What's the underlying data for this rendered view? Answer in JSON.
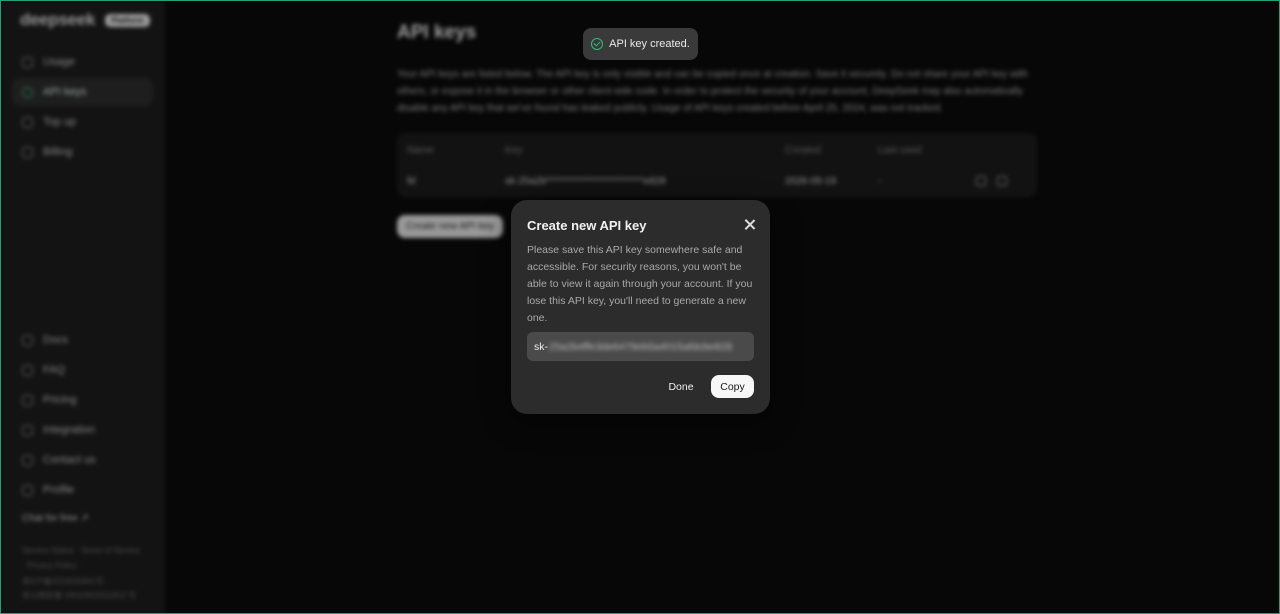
{
  "sidebar": {
    "logo": "deepseek",
    "tag": "Platform",
    "nav_top": [
      {
        "label": "Usage",
        "icon": "chart-icon"
      },
      {
        "label": "API keys",
        "icon": "search-icon"
      },
      {
        "label": "Top up",
        "icon": "wallet-icon"
      },
      {
        "label": "Billing",
        "icon": "doc-icon"
      }
    ],
    "nav_bottom": [
      {
        "label": "Docs",
        "icon": "file-icon"
      },
      {
        "label": "FAQ",
        "icon": "question-icon"
      },
      {
        "label": "Pricing",
        "icon": "tag-icon"
      },
      {
        "label": "Integration",
        "icon": "gear-icon"
      },
      {
        "label": "Contact us",
        "icon": "chat-icon"
      },
      {
        "label": "Profile",
        "icon": "user-icon"
      }
    ],
    "chat_free": "Chat for free ↗",
    "footer": [
      "Service Status · Terms of Service",
      "· Privacy Policy ·",
      "浙ICP备2023025841号 ·",
      "浙公网安备 33010502011812 号"
    ]
  },
  "main": {
    "title": "API keys",
    "description": "Your API keys are listed below. The API key is only visible and can be copied once at creation. Save it securely. Do not share your API key with others, or expose it in the browser or other client-side code. In order to protect the security of your account, DeepSeek may also automatically disable any API key that we've found has leaked publicly. Usage of API keys created before April 25, 2024, was not tracked.",
    "table": {
      "headers": [
        "Name",
        "Key",
        "Created",
        "Last used"
      ],
      "rows": [
        {
          "name": "fd",
          "key": "sk-25a2b*************************e828",
          "created": "2026-05-19",
          "last_used": "-"
        }
      ]
    },
    "create_button": "Create new API key"
  },
  "toast": {
    "text": "API key created.",
    "color": "#2fbf71"
  },
  "modal": {
    "title": "Create new API key",
    "description": "Please save this API key somewhere safe and accessible. For security reasons, you won't be able to view it again through your account. If you lose this API key, you'll need to generate a new one.",
    "key_prefix": "sk-",
    "key_rest": "25a2b4ffe3de6479eb5a4015afdcbe828",
    "done_label": "Done",
    "copy_label": "Copy"
  }
}
